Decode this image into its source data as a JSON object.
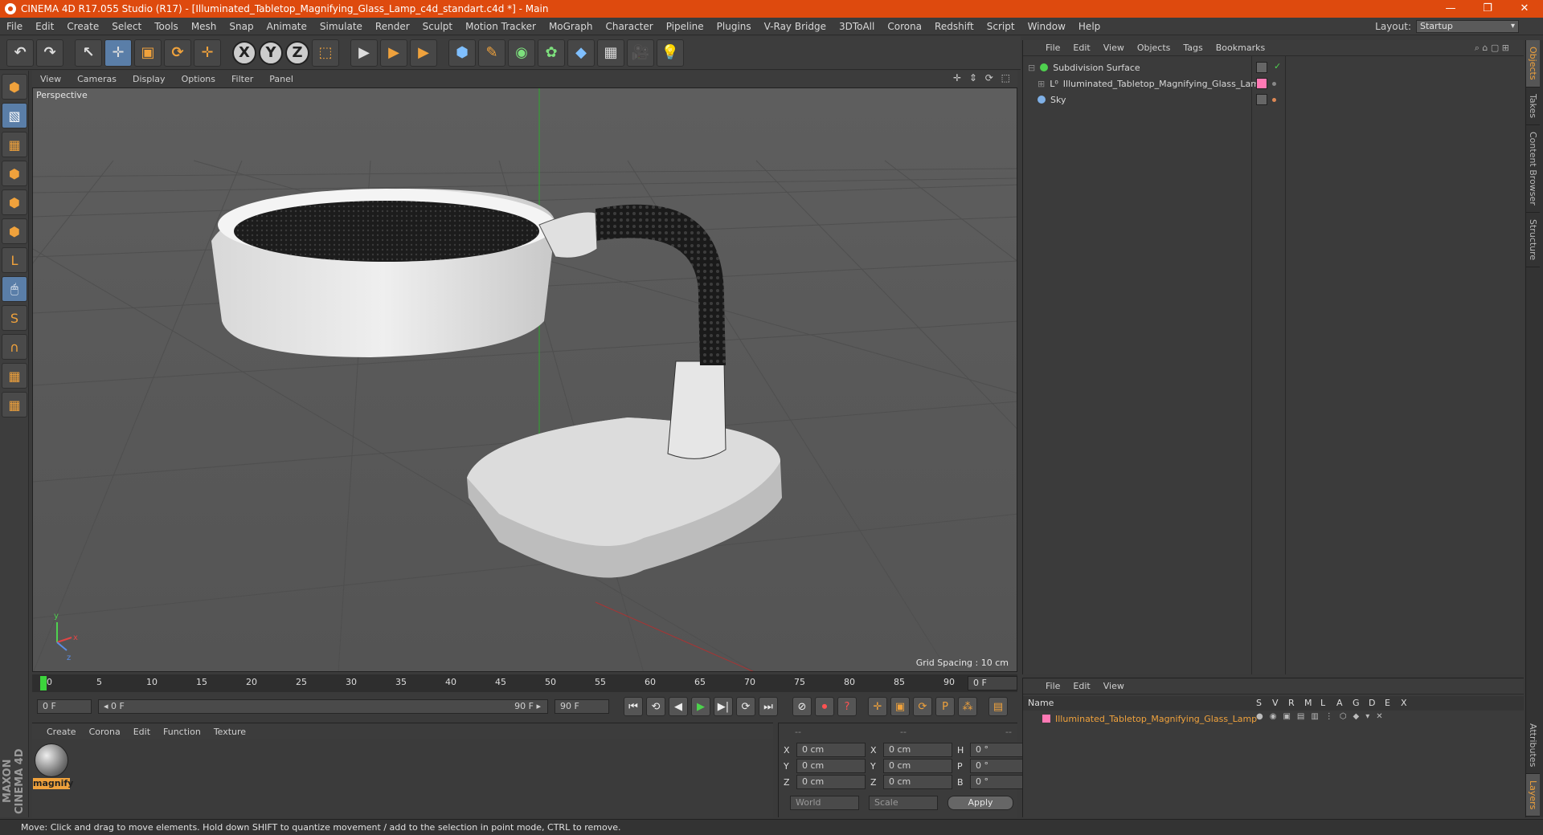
{
  "window": {
    "title": "CINEMA 4D R17.055 Studio (R17) - [Illuminated_Tabletop_Magnifying_Glass_Lamp_c4d_standart.c4d *] - Main",
    "minimize": "—",
    "restore": "❐",
    "close": "✕"
  },
  "menubar": {
    "items": [
      "File",
      "Edit",
      "Create",
      "Select",
      "Tools",
      "Mesh",
      "Snap",
      "Animate",
      "Simulate",
      "Render",
      "Sculpt",
      "Motion Tracker",
      "MoGraph",
      "Character",
      "Pipeline",
      "Plugins",
      "V-Ray Bridge",
      "3DToAll",
      "Corona",
      "Redshift",
      "Script",
      "Window",
      "Help"
    ],
    "layout_label": "Layout:",
    "layout_value": "Startup"
  },
  "toolbar": {
    "undo": "↶",
    "redo": "↷",
    "select": "↖",
    "move": "✛",
    "scale": "▣",
    "rotate": "⟳",
    "add": "✛",
    "x": "X",
    "y": "Y",
    "z": "Z",
    "coord": "⬚",
    "render1": "▶",
    "render2": "▶",
    "render3": "▶",
    "cube": "⬢",
    "pen": "✎",
    "subdiv": "◉",
    "mograph": "✿",
    "deform": "◆",
    "floor": "▦",
    "camera": "🎥",
    "light": "💡"
  },
  "lefttools": [
    "⬢",
    "▧",
    "▦",
    "⬢",
    "⬢",
    "⬢",
    "L",
    "🖱",
    "S",
    "∩",
    "▦",
    "▦"
  ],
  "viewport": {
    "menu": [
      "View",
      "Cameras",
      "Display",
      "Options",
      "Filter",
      "Panel"
    ],
    "nav_icons": "✛ ⇕ ⟳ ⬚",
    "label": "Perspective",
    "grid_spacing": "Grid Spacing : 10 cm",
    "axis_y": "y",
    "axis_x": "x",
    "axis_z": "z"
  },
  "timeline": {
    "ticks": [
      "0",
      "5",
      "10",
      "15",
      "20",
      "25",
      "30",
      "35",
      "40",
      "45",
      "50",
      "55",
      "60",
      "65",
      "70",
      "75",
      "80",
      "85",
      "90"
    ],
    "current_frame": "0 F"
  },
  "transport": {
    "start": "0 F",
    "range_start": "◂ 0 F",
    "range_end": "90 F ▸",
    "end": "90 F",
    "buttons": [
      "⏮",
      "⟲",
      "◀",
      "▶",
      "▶|",
      "⟳",
      "⏭"
    ],
    "record_buttons": [
      "⊘",
      "⏺",
      "?",
      "✛",
      "▣",
      "⟳",
      "P",
      "⁂",
      "▤"
    ]
  },
  "material_panel": {
    "menu": [
      "Create",
      "Corona",
      "Edit",
      "Function",
      "Texture"
    ],
    "material_name": "magnify"
  },
  "coords_panel": {
    "header": [
      "--",
      "--",
      "--"
    ],
    "rows": [
      {
        "a": "X",
        "av": "0 cm",
        "b": "X",
        "bv": "0 cm",
        "c": "H",
        "cv": "0 °"
      },
      {
        "a": "Y",
        "av": "0 cm",
        "b": "Y",
        "bv": "0 cm",
        "c": "P",
        "cv": "0 °"
      },
      {
        "a": "Z",
        "av": "0 cm",
        "b": "Z",
        "bv": "0 cm",
        "c": "B",
        "cv": "0 °"
      }
    ],
    "world": "World",
    "scale": "Scale",
    "apply": "Apply"
  },
  "object_manager": {
    "menu": [
      "File",
      "Edit",
      "View",
      "Objects",
      "Tags",
      "Bookmarks"
    ],
    "objects": [
      {
        "name": "Subdivision Surface",
        "color": "#4fd14f"
      },
      {
        "name": "Illuminated_Tabletop_Magnifying_Glass_Lamp",
        "color": "#ff79b4"
      },
      {
        "name": "Sky",
        "color": "#7fb0e6"
      }
    ]
  },
  "layer_manager": {
    "menu": [
      "File",
      "Edit",
      "View"
    ],
    "columns": [
      "Name",
      "S",
      "V",
      "R",
      "M",
      "L",
      "A",
      "G",
      "D",
      "E",
      "X"
    ],
    "layer_name": "Illuminated_Tabletop_Magnifying_Glass_Lamp",
    "layer_color": "#ff79b4"
  },
  "side_tabs": [
    "Objects",
    "Takes",
    "Content Browser",
    "Structure"
  ],
  "side_tabs_bottom": [
    "Attributes",
    "Layers"
  ],
  "brand": "MAXON CINEMA 4D",
  "statusbar": "Move: Click and drag to move elements. Hold down SHIFT to quantize movement / add to the selection in point mode, CTRL to remove.",
  "colors": {
    "titlebar": "#de4a0e",
    "accent": "#f0a23c",
    "selected": "#5a7ea8"
  }
}
